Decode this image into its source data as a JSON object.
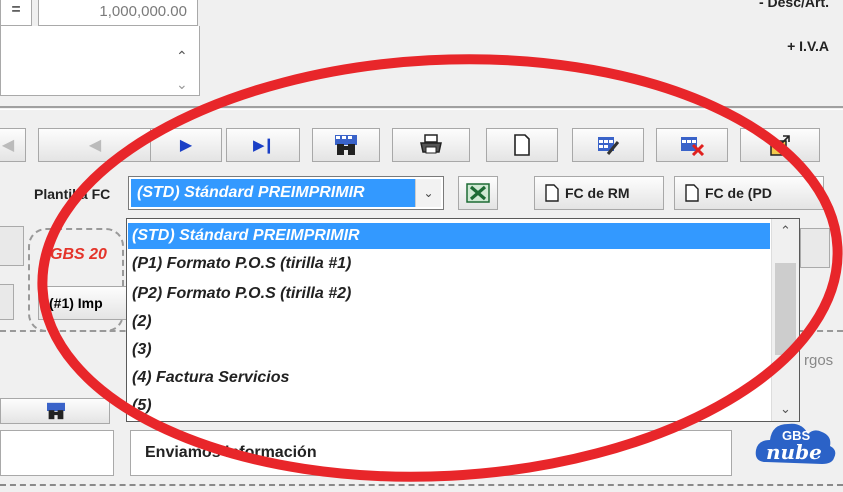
{
  "top": {
    "equals_sign": "=",
    "amount": "1,000,000.00",
    "desc_label": "- Desc/Art.",
    "iva_label": "+ I.V.A"
  },
  "toolbar": {
    "icons": [
      "prev-record-icon",
      "play-next-icon",
      "last-record-icon",
      "search-binoculars-icon",
      "print-icon",
      "new-document-icon",
      "edit-grid-icon",
      "delete-grid-icon",
      "export-icon"
    ]
  },
  "plantilla": {
    "label": "Plantilla FC",
    "selected": "(STD) Stándard PREIMPRIMIR",
    "fc_rm_label": "FC de RM",
    "fc_pd_label": "FC de (PD"
  },
  "dropdown": {
    "options": [
      "(STD) Stándard PREIMPRIMIR",
      " (P1) Formato P.O.S (tirilla #1)",
      "(P2) Formato P.O.S (tirilla #2)",
      "(2)",
      "(3)",
      "(4) Factura Servicios",
      "(5)"
    ],
    "selected_index": 0
  },
  "left_panel": {
    "gbs_label": "GBS 20",
    "imp_button_label": "(#1) Imp"
  },
  "right_panel": {
    "cargos_text": "rgos"
  },
  "bottom": {
    "message": "Enviamos información",
    "nube_logo_top": "GBS",
    "nube_logo_bottom": "nube"
  },
  "colors": {
    "selection": "#3399ff",
    "annotation_red": "#e8262a",
    "toolbar_blue": "#1a3fc6"
  }
}
